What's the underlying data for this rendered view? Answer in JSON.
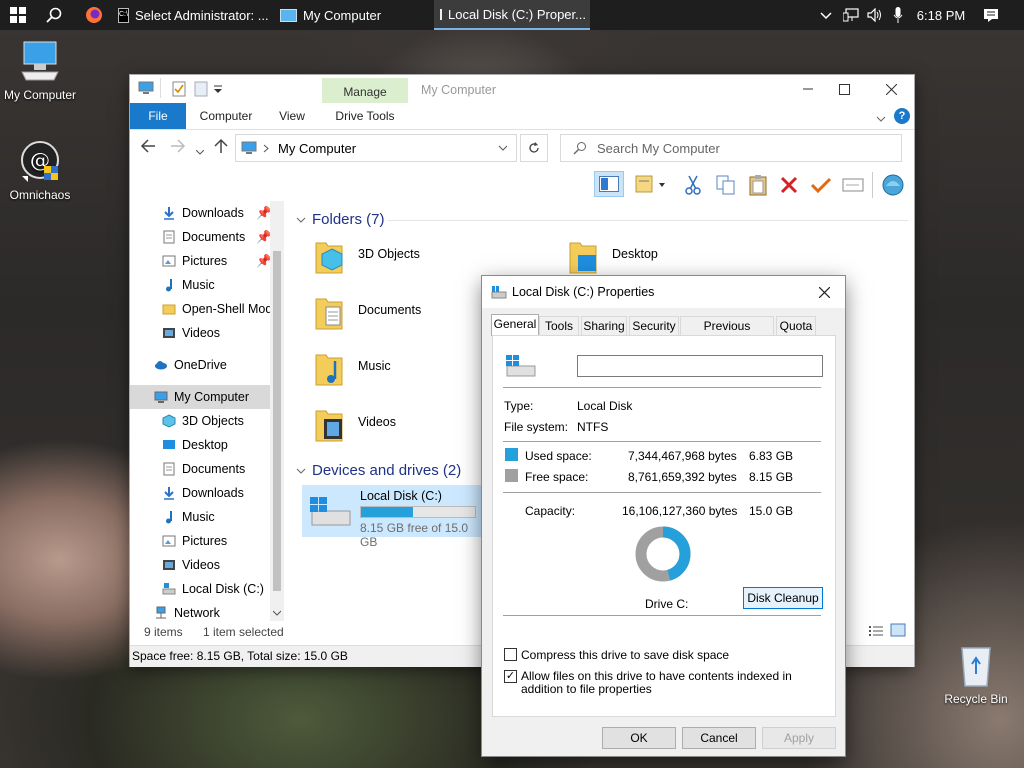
{
  "taskbar": {
    "buttons": [
      {
        "label": "Select Administrator: ..."
      },
      {
        "label": "My Computer"
      },
      {
        "label": "Local Disk (C:) Proper..."
      }
    ],
    "clock": "6:18 PM"
  },
  "desktop": {
    "icons": [
      {
        "label": "My Computer"
      },
      {
        "label": "Omnichaos"
      },
      {
        "label": "Recycle Bin"
      }
    ]
  },
  "explorer": {
    "title": "My Computer",
    "manage_tab": "Manage",
    "tabs": [
      "File",
      "Computer",
      "View",
      "Drive Tools"
    ],
    "address": "My Computer",
    "search_placeholder": "Search My Computer",
    "nav": [
      {
        "label": "Downloads",
        "pinned": true
      },
      {
        "label": "Documents",
        "pinned": true
      },
      {
        "label": "Pictures",
        "pinned": true
      },
      {
        "label": "Music"
      },
      {
        "label": "Open-Shell Mod"
      },
      {
        "label": "Videos"
      },
      {
        "label": "OneDrive"
      },
      {
        "label": "My Computer"
      },
      {
        "label": "3D Objects"
      },
      {
        "label": "Desktop"
      },
      {
        "label": "Documents"
      },
      {
        "label": "Downloads"
      },
      {
        "label": "Music"
      },
      {
        "label": "Pictures"
      },
      {
        "label": "Videos"
      },
      {
        "label": "Local Disk (C:)"
      },
      {
        "label": "Network"
      }
    ],
    "folders_header": "Folders (7)",
    "folders": [
      "3D Objects",
      "Desktop",
      "Documents",
      "Music",
      "Videos"
    ],
    "devices_header": "Devices and drives (2)",
    "drive": {
      "name": "Local Disk (C:)",
      "free_text": "8.15 GB free of 15.0 GB",
      "used_fraction": 0.456
    },
    "status_items": "9 items",
    "status_selected": "1 item selected",
    "bottom_status": "Space free: 8.15 GB, Total size: 15.0 GB"
  },
  "dialog": {
    "title": "Local Disk (C:) Properties",
    "tabs": [
      "General",
      "Tools",
      "Sharing",
      "Security",
      "Previous Versions",
      "Quota"
    ],
    "name_value": "",
    "type_label": "Type:",
    "type_value": "Local Disk",
    "fs_label": "File system:",
    "fs_value": "NTFS",
    "used_label": "Used space:",
    "used_bytes": "7,344,467,968 bytes",
    "used_gb": "6.83 GB",
    "free_label": "Free space:",
    "free_bytes": "8,761,659,392 bytes",
    "free_gb": "8.15 GB",
    "cap_label": "Capacity:",
    "cap_bytes": "16,106,127,360 bytes",
    "cap_gb": "15.0 GB",
    "used_fraction": 0.456,
    "drive_label": "Drive C:",
    "cleanup": "Disk Cleanup",
    "compress": {
      "label": "Compress this drive to save disk space",
      "checked": false
    },
    "index": {
      "label": "Allow files on this drive to have contents indexed in addition to file properties",
      "checked": true
    },
    "ok": "OK",
    "cancel": "Cancel",
    "apply": "Apply",
    "colors": {
      "used": "#26a0da",
      "free": "#a0a0a0"
    }
  }
}
